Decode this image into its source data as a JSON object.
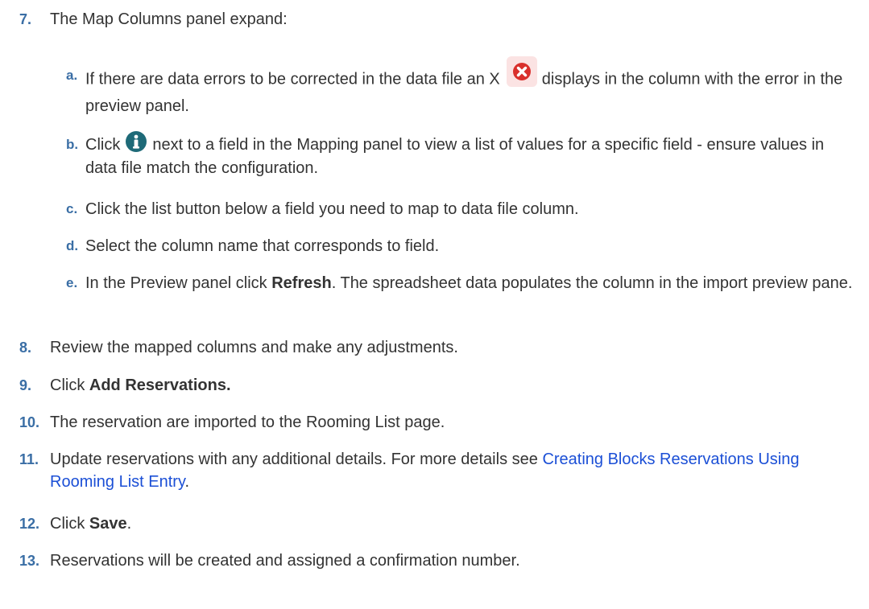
{
  "steps": [
    {
      "num": "7.",
      "text": "The Map Columns panel expand:"
    },
    {
      "num": "8.",
      "text": "Review the mapped columns and make any adjustments."
    },
    {
      "num": "9.",
      "pre": "Click ",
      "bold": "Add Reservations."
    },
    {
      "num": "10.",
      "text": "The reservation are imported to the Rooming List page."
    },
    {
      "num": "11.",
      "pre": "Update reservations with any additional details. For more details see ",
      "link": "Creating Blocks Reservations Using Rooming List Entry",
      "post": "."
    },
    {
      "num": "12.",
      "pre": "Click ",
      "bold": "Save",
      "post": "."
    },
    {
      "num": "13.",
      "text": "Reservations will be created and assigned a confirmation number."
    }
  ],
  "substeps": [
    {
      "num": "a.",
      "pre": "If there are data errors to be corrected in the data file an X",
      "post": "displays in the column with the error in the preview panel."
    },
    {
      "num": "b.",
      "pre": "Click",
      "post": "next to a field in the Mapping panel to view a list of values for a specific field - ensure values in data file match the configuration."
    },
    {
      "num": "c.",
      "text": "Click the list button below a field you need to map to data file column."
    },
    {
      "num": "d.",
      "text": "Select the column name that corresponds to field."
    },
    {
      "num": "e.",
      "pre": "In the Preview panel click ",
      "bold": "Refresh",
      "post": ". The spreadsheet data populates the column in the import preview pane."
    }
  ],
  "icons": {
    "error": "error-x-icon",
    "info": "info-icon"
  },
  "colors": {
    "number": "#3a6ea5",
    "link": "#1b4fd6",
    "error_icon": "#d9302c",
    "info_icon": "#1e6a78"
  }
}
